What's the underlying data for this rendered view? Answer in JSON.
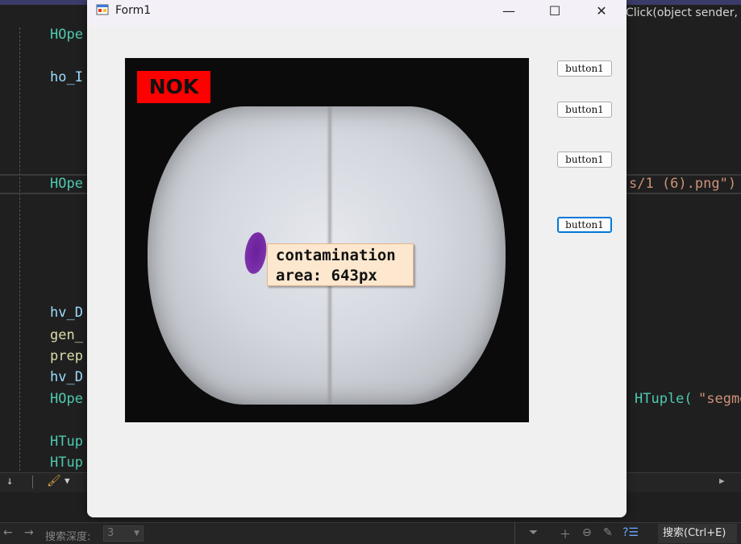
{
  "editor": {
    "tab_fragment": "Click(object sender,",
    "lines": [
      {
        "text": "HOpe",
        "color": "teal"
      },
      {
        "text": "ho_I",
        "color": "fn"
      },
      {
        "text": "HOpe",
        "color": "teal"
      },
      {
        "text": "hv_D",
        "color": "fn"
      },
      {
        "text": "gen_",
        "color": "yellow"
      },
      {
        "text": "prep",
        "color": "yellow"
      },
      {
        "text": "hv_D",
        "color": "fn"
      },
      {
        "text": "HOpe",
        "color": "teal"
      },
      {
        "text": "HTup",
        "color": "teal"
      },
      {
        "text": "HTup",
        "color": "teal"
      }
    ],
    "right_fragment_1": "s/1 (6).png\")",
    "right_fragment_2_a": "HTuple(",
    "right_fragment_2_b": "\"segme"
  },
  "find_bar": {
    "label": "搜索深度:",
    "depth_value": "3",
    "search_button": "搜索(Ctrl+E)"
  },
  "form": {
    "title": "Form1",
    "minimize_glyph": "—",
    "maximize_glyph": "☐",
    "close_glyph": "✕",
    "result_badge": "NOK",
    "defect_label_line1": "contamination",
    "defect_label_line2": "area: 643px",
    "buttons": [
      "button1",
      "button1",
      "button1",
      "button1"
    ]
  },
  "colors": {
    "badge": "#ff0000",
    "label_bg": "#fde7ce",
    "stain": "#7a2fa8"
  }
}
